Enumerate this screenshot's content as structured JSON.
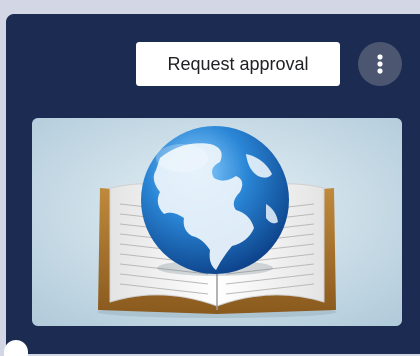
{
  "card": {
    "actions": {
      "request_label": "Request approval",
      "more_icon": "more-vert-icon"
    },
    "image": {
      "subject": "globe-on-open-book",
      "colors": {
        "background": "#c8dde8",
        "globe_ocean": "#1f74c4",
        "globe_land": "#eaf3fb",
        "book_cover": "#a8742e",
        "book_pages": "#f6f6f6"
      }
    }
  }
}
